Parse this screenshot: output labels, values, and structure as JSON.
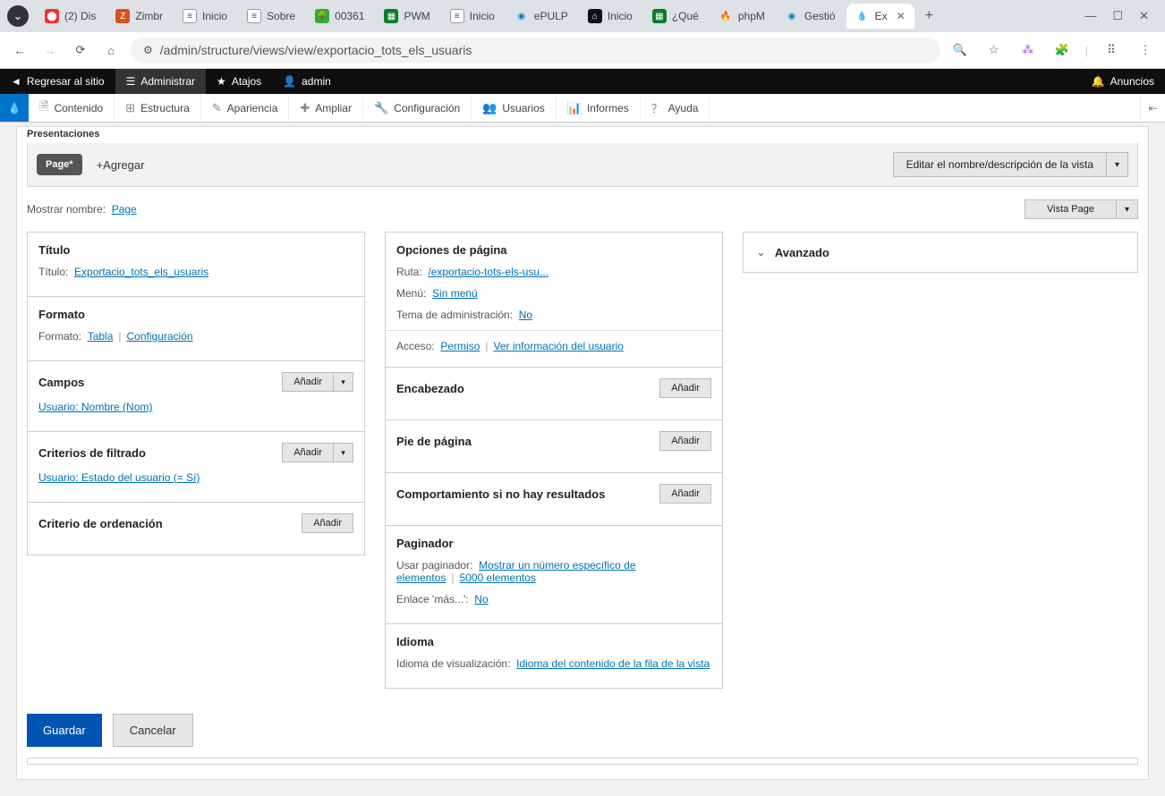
{
  "browser": {
    "tabs": [
      {
        "label": "(2) Dis"
      },
      {
        "label": "Zimbr"
      },
      {
        "label": "Inicio"
      },
      {
        "label": "Sobre"
      },
      {
        "label": "00361"
      },
      {
        "label": "PWM"
      },
      {
        "label": "Inicio"
      },
      {
        "label": "ePULP"
      },
      {
        "label": "Inicio"
      },
      {
        "label": "¿Qué"
      },
      {
        "label": "phpM"
      },
      {
        "label": "Gestió"
      },
      {
        "label": "Ex",
        "active": true
      }
    ],
    "url": "/admin/structure/views/view/exportacio_tots_els_usuaris"
  },
  "drupal_top": {
    "back": "Regresar al sitio",
    "admin": "Administrar",
    "shortcuts": "Atajos",
    "user": "admin",
    "announce": "Anuncios"
  },
  "drupal_nav": {
    "items": [
      "Contenido",
      "Estructura",
      "Apariencia",
      "Ampliar",
      "Configuración",
      "Usuarios",
      "Informes",
      "Ayuda"
    ]
  },
  "section_label": "Presentaciones",
  "pres": {
    "page_chip": "Page*",
    "add": "+Agregar",
    "edit_name": "Editar el nombre/descripción de la vista"
  },
  "show_row": {
    "label": "Mostrar nombre:",
    "value": "Page",
    "view_select": "Vista Page"
  },
  "left": {
    "titulo": {
      "heading": "Título",
      "label": "Título:",
      "value": "Exportacio_tots_els_usuaris"
    },
    "formato": {
      "heading": "Formato",
      "label": "Formato:",
      "value": "Tabla",
      "config": "Configuración"
    },
    "campos": {
      "heading": "Campos",
      "add": "Añadir",
      "item": "Usuario: Nombre (Nom)"
    },
    "filtros": {
      "heading": "Criterios de filtrado",
      "add": "Añadir",
      "item": "Usuario: Estado del usuario (= Sí)"
    },
    "orden": {
      "heading": "Criterio de ordenación",
      "add": "Añadir"
    }
  },
  "mid": {
    "opciones": {
      "heading": "Opciones de página",
      "ruta_label": "Ruta:",
      "ruta_value": "/exportacio-tots-els-usu...",
      "menu_label": "Menú:",
      "menu_value": "Sin menú",
      "tema_label": "Tema de administración:",
      "tema_value": "No",
      "acceso_label": "Acceso:",
      "acceso_value": "Permiso",
      "acceso_info": "Ver información del usuario"
    },
    "encabezado": {
      "heading": "Encabezado",
      "add": "Añadir"
    },
    "pie": {
      "heading": "Pie de página",
      "add": "Añadir"
    },
    "noresults": {
      "heading": "Comportamiento si no hay resultados",
      "add": "Añadir"
    },
    "paginador": {
      "heading": "Paginador",
      "usar_label": "Usar paginador:",
      "usar_value": "Mostrar un número específico de elementos",
      "count": "5000 elementos",
      "mas_label": "Enlace 'más...':",
      "mas_value": "No"
    },
    "idioma": {
      "heading": "Idioma",
      "label": "Idioma de visualización:",
      "value": "Idioma del contenido de la fila de la vista"
    }
  },
  "right": {
    "advanced": "Avanzado"
  },
  "actions": {
    "save": "Guardar",
    "cancel": "Cancelar"
  }
}
